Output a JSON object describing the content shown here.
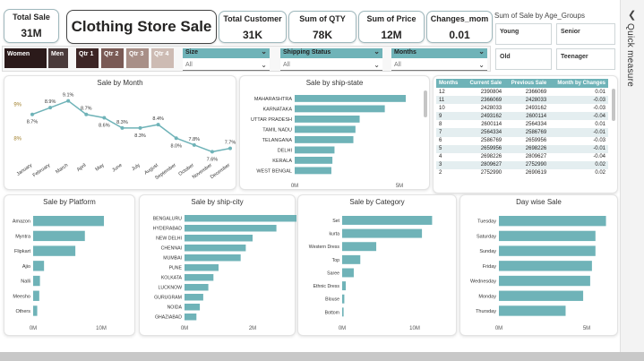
{
  "kpis": {
    "total_sale_label": "Total Sale",
    "total_sale_value": "31M",
    "title": "Clothing Store Sale",
    "total_customer_label": "Total Customer",
    "total_customer_value": "31K",
    "sum_qty_label": "Sum of QTY",
    "sum_qty_value": "78K",
    "sum_price_label": "Sum of Price",
    "sum_price_value": "12M",
    "changes_label": "Changes_mom",
    "changes_value": "0.01"
  },
  "age_groups": {
    "title": "Sum of Sale by Age_Groups",
    "items": [
      "Young",
      "Senior",
      "Old",
      "Teenager"
    ]
  },
  "side_panel": {
    "label": "Quick measure"
  },
  "slicers": {
    "gender": [
      "Women",
      "Men"
    ],
    "quarters": [
      "Qtr 1",
      "Qtr 2",
      "Qtr 3",
      "Qtr 4"
    ],
    "size": {
      "label": "Size",
      "value": "All"
    },
    "shipping": {
      "label": "Shipping Status",
      "value": "All"
    },
    "months": {
      "label": "Months",
      "value": "All"
    }
  },
  "colors": {
    "bar": "#6fb3b8",
    "line": "#6fb3b8",
    "header": "#6fb3b8"
  },
  "sale_by_month": {
    "title": "Sale by Month",
    "chart_data": {
      "type": "line",
      "x": [
        "January",
        "February",
        "March",
        "April",
        "May",
        "June",
        "July",
        "August",
        "September",
        "October",
        "November",
        "December"
      ],
      "labels": [
        "8.7%",
        "8.9%",
        "9.1%",
        "8.7%",
        "8.6%",
        "8.3%",
        "8.3%",
        "8.4%",
        "8.0%",
        "7.8%",
        "7.6%",
        "7.7%"
      ],
      "values": [
        8.7,
        8.9,
        9.1,
        8.7,
        8.6,
        8.3,
        8.3,
        8.4,
        8.0,
        7.8,
        7.6,
        7.7
      ],
      "y_ticks": [
        "9%",
        "8%"
      ],
      "ylim": [
        7.4,
        9.3
      ]
    }
  },
  "sale_by_state": {
    "title": "Sale by ship-state",
    "chart_data": {
      "type": "bar",
      "categories": [
        "MAHARASHTRA",
        "KARNATAKA",
        "UTTAR PRADESH",
        "TAMIL NADU",
        "TELANGANA",
        "DELHI",
        "KERALA",
        "WEST BENGAL"
      ],
      "values": [
        5.3,
        4.3,
        3.1,
        2.9,
        2.8,
        1.9,
        1.8,
        1.75
      ],
      "x_ticks": [
        "0M",
        "5M"
      ],
      "xlim": [
        0,
        5
      ]
    }
  },
  "month_table": {
    "headers": [
      "Months",
      "Current Sale",
      "Previous Sale",
      "Month by Changes"
    ],
    "rows": [
      [
        "12",
        "2390804",
        "2366069",
        "0.01"
      ],
      [
        "11",
        "2366069",
        "2428033",
        "-0.03"
      ],
      [
        "10",
        "2428033",
        "2493162",
        "-0.03"
      ],
      [
        "9",
        "2493162",
        "2600114",
        "-0.04"
      ],
      [
        "8",
        "2600114",
        "2564334",
        "0.01"
      ],
      [
        "7",
        "2564334",
        "2586769",
        "-0.01"
      ],
      [
        "6",
        "2586769",
        "2659956",
        "-0.03"
      ],
      [
        "5",
        "2659956",
        "2698226",
        "-0.01"
      ],
      [
        "4",
        "2698226",
        "2809627",
        "-0.04"
      ],
      [
        "3",
        "2809627",
        "2752990",
        "0.02"
      ],
      [
        "2",
        "2752990",
        "2690619",
        "0.02"
      ]
    ]
  },
  "sale_by_platform": {
    "title": "Sale by Platform",
    "chart_data": {
      "type": "bar",
      "categories": [
        "Amazon",
        "Myntra",
        "Flipkart",
        "Ajio",
        "Nalli",
        "Meesho",
        "Others"
      ],
      "values": [
        10.4,
        7.6,
        6.2,
        1.6,
        1.0,
        0.9,
        0.6
      ],
      "x_ticks": [
        "0M",
        "10M"
      ],
      "xlim": [
        0,
        10
      ]
    }
  },
  "sale_by_city": {
    "title": "Sale by ship-city",
    "chart_data": {
      "type": "bar",
      "categories": [
        "BENGALURU",
        "HYDERABAD",
        "NEW DELHI",
        "CHENNAI",
        "MUMBAI",
        "PUNE",
        "KOLKATA",
        "LUCKNOW",
        "GURUGRAM",
        "NOIDA",
        "GHAZIABAD"
      ],
      "values": [
        3.3,
        2.7,
        2.0,
        1.8,
        1.65,
        1.0,
        0.85,
        0.7,
        0.55,
        0.45,
        0.35
      ],
      "x_ticks": [
        "0M",
        "2M"
      ],
      "xlim": [
        0,
        2
      ]
    }
  },
  "sale_by_category": {
    "title": "Sale by Category",
    "chart_data": {
      "type": "bar",
      "categories": [
        "Set",
        "kurta",
        "Western Dress",
        "Top",
        "Saree",
        "Ethnic Dress",
        "Blouse",
        "Bottom"
      ],
      "values": [
        12.4,
        11.0,
        4.7,
        2.5,
        1.6,
        0.5,
        0.3,
        0.2
      ],
      "x_ticks": [
        "0M",
        "10M"
      ],
      "xlim": [
        0,
        10
      ]
    }
  },
  "day_wise": {
    "title": "Day wise Sale",
    "chart_data": {
      "type": "bar",
      "categories": [
        "Tuesday",
        "Saturday",
        "Sunday",
        "Friday",
        "Wednesday",
        "Monday",
        "Thursday"
      ],
      "values": [
        6.1,
        5.5,
        5.5,
        5.3,
        5.2,
        4.8,
        3.8
      ],
      "x_ticks": [
        "0M",
        "5M"
      ],
      "xlim": [
        0,
        5
      ]
    }
  }
}
